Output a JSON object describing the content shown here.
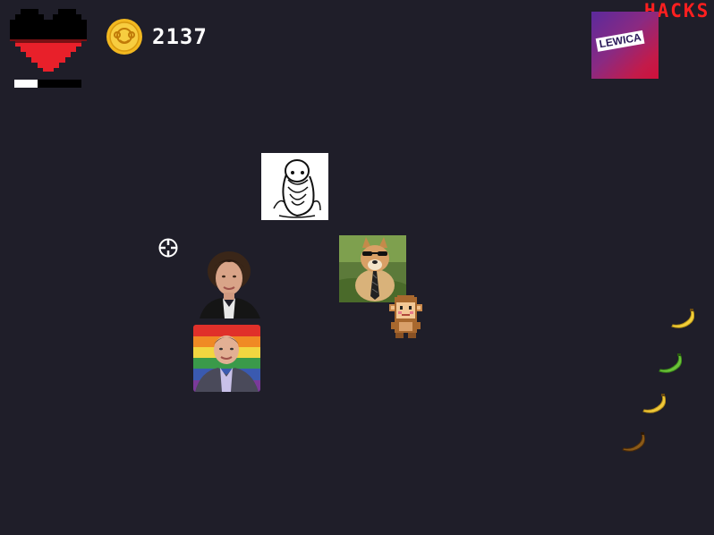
{
  "hud": {
    "health_fraction": 0.35,
    "coin_count": "2137",
    "hacks_label": "HACKS",
    "party_logo_text": "LEWICA"
  },
  "colors": {
    "background": "#1f1e29",
    "heart_top": "#000000",
    "heart_bottom": "#e8202a",
    "coin_gold": "#f2b820",
    "hacks_red": "#ff1f1f"
  },
  "icons": {
    "heart": "heart-icon",
    "coin": "monkey-coin-icon",
    "crosshair": "crosshair-icon",
    "banana": "banana-icon"
  },
  "bananas": [
    {
      "ripeness": "yellow"
    },
    {
      "ripeness": "green"
    },
    {
      "ripeness": "yellow"
    },
    {
      "ripeness": "brown"
    }
  ]
}
